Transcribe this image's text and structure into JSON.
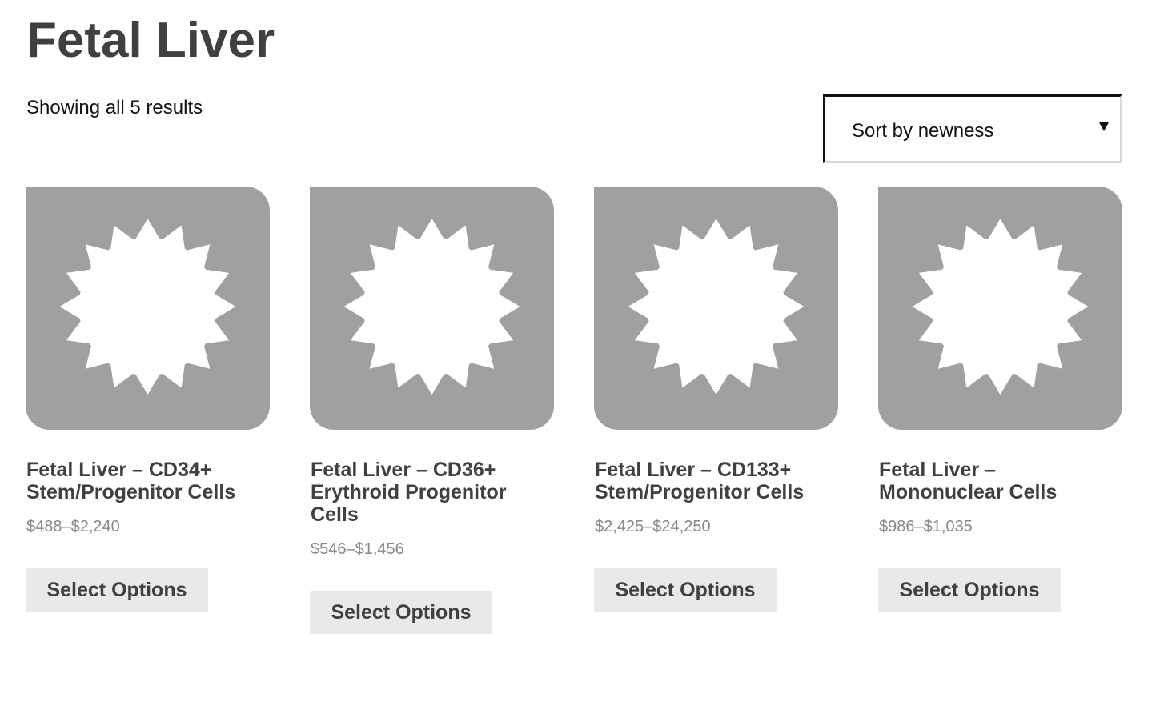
{
  "page": {
    "title": "Fetal Liver",
    "result_count": "Showing all 5 results"
  },
  "sort": {
    "selected": "Sort by newness"
  },
  "products": [
    {
      "name": "Fetal Liver – CD34+ Stem/Progenitor Cells",
      "price": "$488–$2,240",
      "button": "Select Options",
      "image_icon": "placeholder-sun-icon"
    },
    {
      "name": "Fetal Liver – CD36+ Erythroid Progenitor Cells",
      "price": "$546–$1,456",
      "button": "Select Options",
      "image_icon": "placeholder-sun-icon"
    },
    {
      "name": "Fetal Liver – CD133+ Stem/Progenitor Cells",
      "price": "$2,425–$24,250",
      "button": "Select Options",
      "image_icon": "placeholder-sun-icon"
    },
    {
      "name": "Fetal Liver – Mononuclear Cells",
      "price": "$986–$1,035",
      "button": "Select Options",
      "image_icon": "placeholder-sun-icon"
    }
  ],
  "colors": {
    "placeholder_gray": "#a0a0a0",
    "title_text": "#404040",
    "price_text": "#888888",
    "button_bg": "#e9e9e9"
  }
}
